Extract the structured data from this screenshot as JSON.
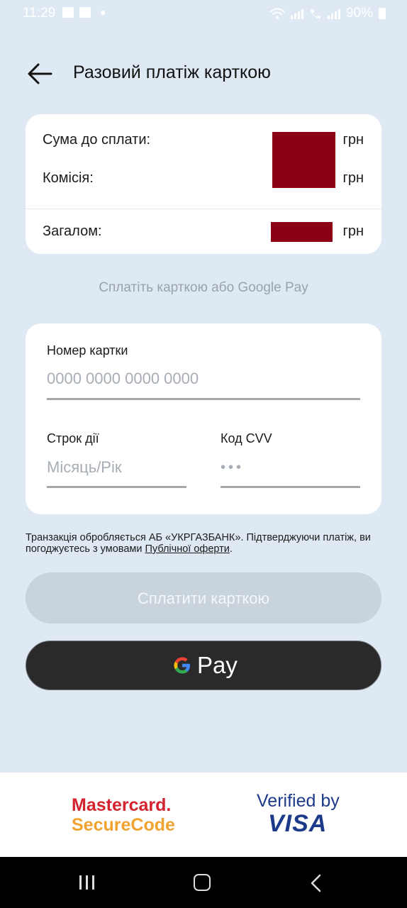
{
  "status_bar": {
    "time": "11:29",
    "battery": "90%"
  },
  "header": {
    "title": "Разовий платіж карткою",
    "back_icon": "arrow-left-icon"
  },
  "summary": {
    "amount_label": "Сума до сплати:",
    "fee_label": "Комісія:",
    "total_label": "Загалом:",
    "currency": "грн",
    "redaction_color": "#8b0015"
  },
  "pay_hint": "Сплатіть карткою або Google Pay",
  "form": {
    "card_number_label": "Номер картки",
    "card_number_placeholder": "0000 0000 0000 0000",
    "expiry_label": "Строк дії",
    "expiry_placeholder": "Місяць/Рік",
    "cvv_label": "Код CVV",
    "cvv_placeholder": "•••"
  },
  "terms": {
    "text": "Транзакція обробляється АБ «УКРГАЗБАНК». Підтверджуючи платіж, ви погоджуєтесь з умовами ",
    "link": "Публічної оферти",
    "end": "."
  },
  "buttons": {
    "pay_card": "Сплатити карткою",
    "gpay": "Pay"
  },
  "footer": {
    "mastercard_line1": "Mastercard.",
    "mastercard_line2": "SecureCode",
    "visa_line1": "Verified by",
    "visa_line2": "VISA"
  },
  "colors": {
    "background": "#dfe9f3",
    "disabled_button": "#c9d3dc",
    "gpay_button": "#2a2a2a"
  }
}
